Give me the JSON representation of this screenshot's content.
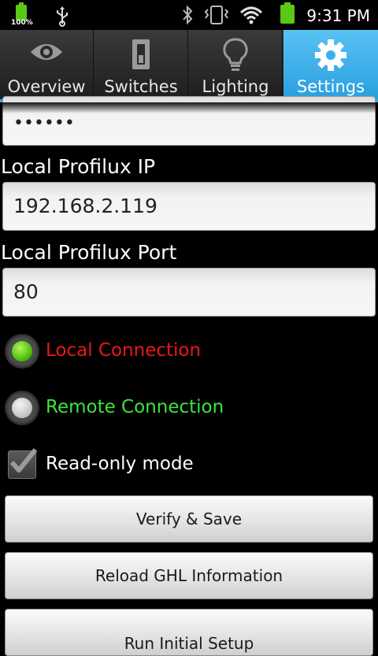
{
  "status_bar": {
    "battery_small_percent": "100%",
    "time": "9:31 PM",
    "icons": [
      "battery-icon",
      "usb-icon",
      "bluetooth-icon",
      "vibrate-icon",
      "wifi-icon",
      "battery-icon"
    ],
    "battery_color": "#5ac814"
  },
  "tabs": [
    {
      "label": "Overview",
      "icon": "eye-icon",
      "active": false
    },
    {
      "label": "Switches",
      "icon": "switch-icon",
      "active": false
    },
    {
      "label": "Lighting",
      "icon": "lightbulb-icon",
      "active": false
    },
    {
      "label": "Settings",
      "icon": "gear-icon",
      "active": true
    }
  ],
  "accent_color": "#2aa8e8",
  "form": {
    "password_value": "••••••",
    "local_ip_label": "Local Profilux IP",
    "local_ip_value": "192.168.2.119",
    "local_port_label": "Local Profilux Port",
    "local_port_value": "80",
    "connection": {
      "local": {
        "label": "Local Connection",
        "selected": true,
        "color": "#e81818"
      },
      "remote": {
        "label": "Remote Connection",
        "selected": false,
        "color": "#3ce43c"
      }
    },
    "readonly": {
      "label": "Read-only mode",
      "checked": true
    }
  },
  "buttons": {
    "verify_save": "Verify & Save",
    "reload_ghl": "Reload GHL Information",
    "partial": "Run Initial Setup"
  }
}
